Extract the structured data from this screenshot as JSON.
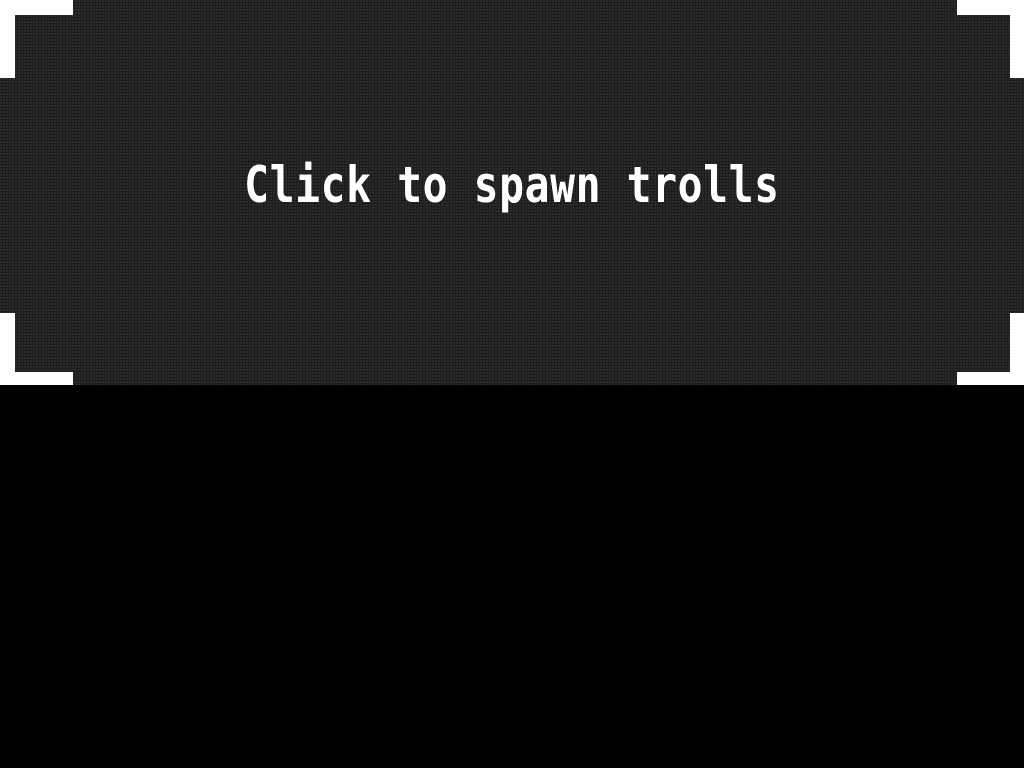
{
  "game": {
    "prompt": "Click to spawn trolls"
  },
  "colors": {
    "background": "#000000",
    "play_area": "#1c1c1c",
    "dither": "#3a3a3a",
    "text": "#ffffff",
    "corner_brackets": "#ffffff"
  }
}
